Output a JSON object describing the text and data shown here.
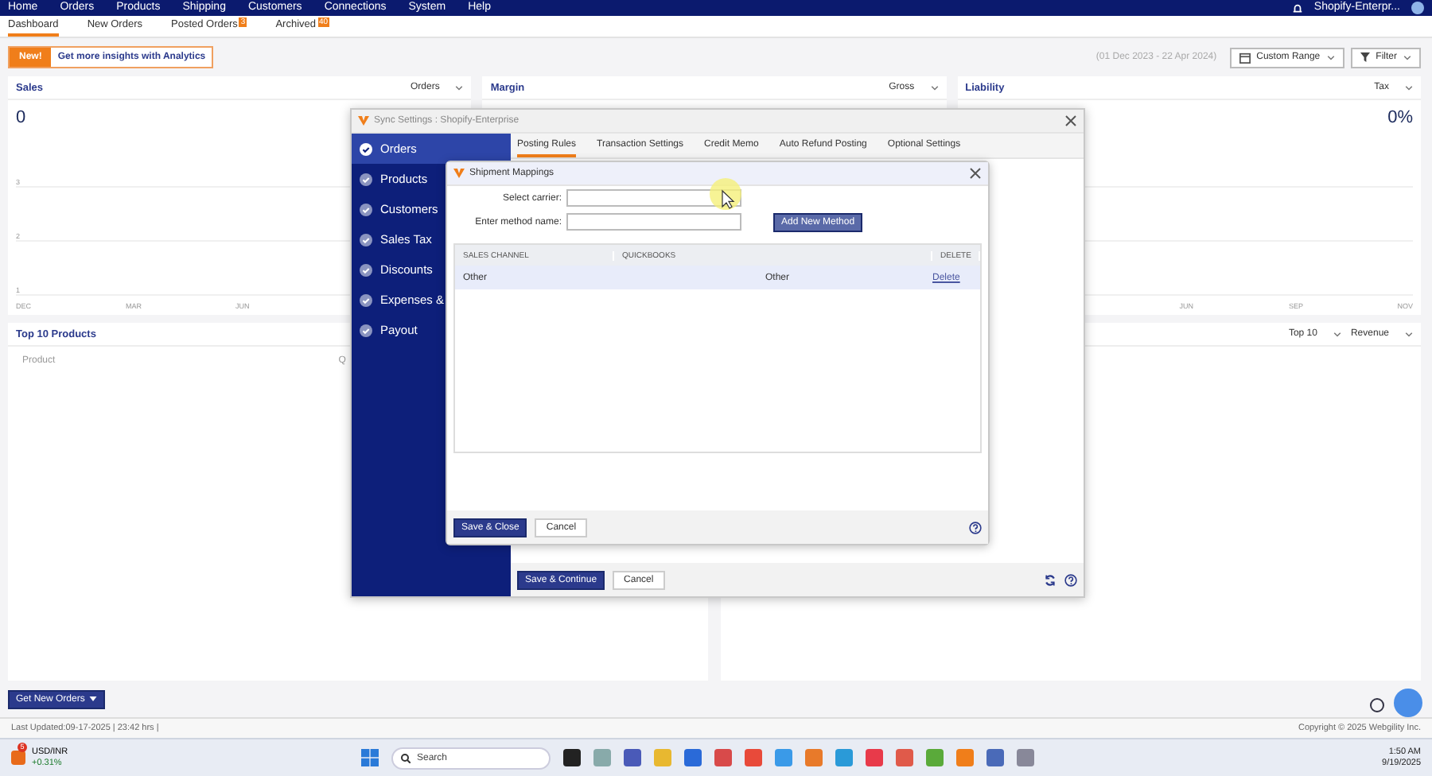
{
  "top_nav": {
    "items": [
      "Home",
      "Orders",
      "Products",
      "Shipping",
      "Customers",
      "Connections",
      "System",
      "Help"
    ],
    "account": "Shopify-Enterpr..."
  },
  "tabs": [
    {
      "label": "Dashboard",
      "selected": true
    },
    {
      "label": "New Orders",
      "selected": false
    },
    {
      "label": "Posted Orders",
      "badge": "3",
      "selected": false
    },
    {
      "label": "Archived",
      "badge": "40",
      "selected": false
    }
  ],
  "promo": {
    "badge": "New!",
    "text": "Get more insights with Analytics"
  },
  "date_range": "(01 Dec 2023 - 22 Apr 2024)",
  "range_button": "Custom Range",
  "filter_button": "Filter",
  "cards": [
    {
      "title": "Sales",
      "dropdown": "Orders",
      "value": "0",
      "y_labels": [
        "3",
        "2",
        "1"
      ],
      "x_labels": [
        "DEC",
        "MAR",
        "JUN"
      ]
    },
    {
      "title": "Margin",
      "dropdown": "Gross"
    },
    {
      "title": "Liability",
      "dropdown": "Tax",
      "value": "0%",
      "x_labels": [
        "JUN",
        "SEP",
        "NOV"
      ]
    }
  ],
  "top_products": {
    "title": "Top 10 Products",
    "columns": [
      "Product",
      "Q"
    ]
  },
  "revenue_card": {
    "dropdowns": [
      "Top 10",
      "Revenue"
    ]
  },
  "get_orders_button": "Get New Orders",
  "footer": {
    "last_updated": "Last Updated:09-17-2025 | 23:42 hrs |",
    "copyright": "Copyright © 2025 Webgility Inc."
  },
  "sync_dialog": {
    "title": "Sync Settings : Shopify-Enterprise",
    "menu": [
      {
        "label": "Orders",
        "selected": true
      },
      {
        "label": "Products",
        "selected": false
      },
      {
        "label": "Customers",
        "selected": false
      },
      {
        "label": "Sales Tax",
        "selected": false
      },
      {
        "label": "Discounts",
        "selected": false
      },
      {
        "label": "Expenses &",
        "selected": false
      },
      {
        "label": "Payout",
        "selected": false
      }
    ],
    "tabs": [
      {
        "label": "Posting Rules",
        "selected": true
      },
      {
        "label": "Transaction Settings",
        "selected": false
      },
      {
        "label": "Credit Memo",
        "selected": false
      },
      {
        "label": "Auto Refund Posting",
        "selected": false
      },
      {
        "label": "Optional Settings",
        "selected": false
      }
    ],
    "buttons": [
      "Save & Continue",
      "Cancel"
    ]
  },
  "shipment_dialog": {
    "title": "Shipment Mappings",
    "carrier_label": "Select carrier:",
    "method_label": "Enter method name:",
    "add_button": "Add New Method",
    "columns": [
      "SALES CHANNEL",
      "QUICKBOOKS",
      "DELETE"
    ],
    "rows": [
      {
        "sales_channel": "Other",
        "quickbooks": "Other",
        "action": "Delete"
      }
    ],
    "buttons": [
      "Save & Close",
      "Cancel"
    ]
  },
  "taskbar": {
    "ticker": "USD/INR",
    "change": "+0.31%",
    "notification_count": "5",
    "search_placeholder": "Search",
    "time": "1:50 AM",
    "date": "9/19/2025"
  }
}
